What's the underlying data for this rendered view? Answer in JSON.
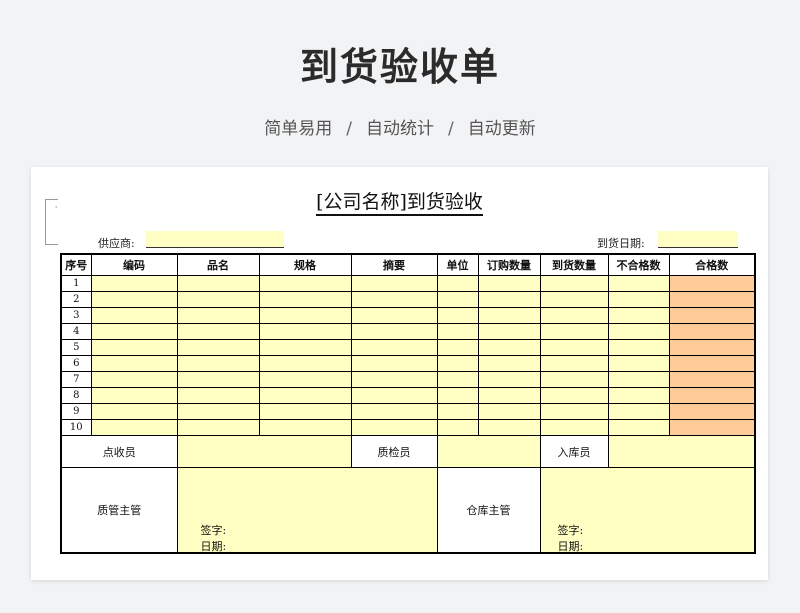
{
  "header": {
    "title": "到货验收单",
    "features": [
      "简单易用",
      "自动统计",
      "自动更新"
    ],
    "separator": "/"
  },
  "doc": {
    "title": "[公司名称]到货验收",
    "supplier_label": "供应商:",
    "supplier_value": "",
    "arrival_date_label": "到货日期:",
    "arrival_date_value": "",
    "columns": [
      "序号",
      "编码",
      "品名",
      "规格",
      "摘要",
      "单位",
      "订购数量",
      "到货数量",
      "不合格数",
      "合格数"
    ],
    "rows": [
      "1",
      "2",
      "3",
      "4",
      "5",
      "6",
      "7",
      "8",
      "9",
      "10"
    ],
    "signoff": {
      "receiver": "点收员",
      "inspector": "质检员",
      "warehouse_clerk": "入库员",
      "quality_manager": "质管主管",
      "warehouse_manager": "仓库主管",
      "sign_label": "签字:",
      "date_label": "日期:"
    }
  },
  "colors": {
    "input_fill": "#ffffc4",
    "computed_fill": "#ffcc99",
    "background": "#f2f3f5"
  }
}
